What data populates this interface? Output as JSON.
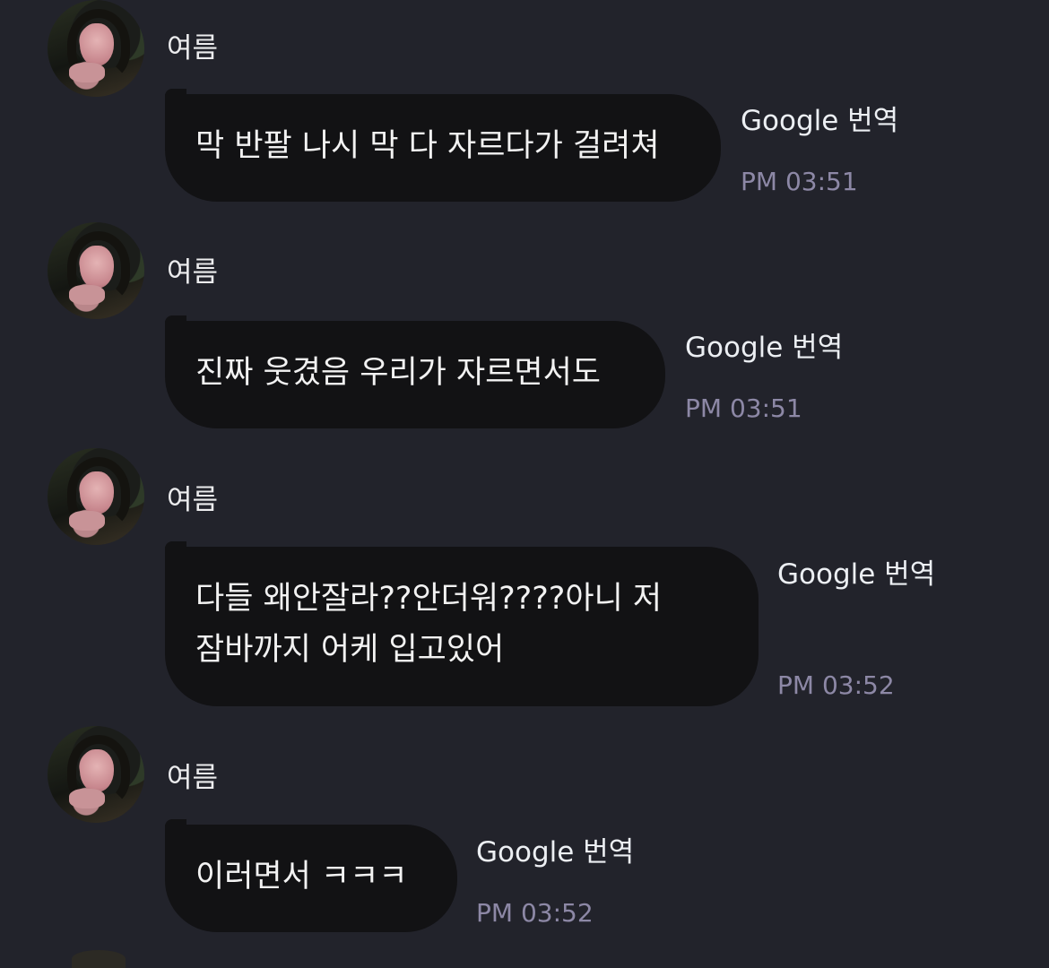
{
  "messages": [
    {
      "sender": "여름",
      "text_lines": [
        "막 반팔 나시 막 다 자르다가 걸려쳐"
      ],
      "translate_label": "Google 번역",
      "time": "PM 03:51"
    },
    {
      "sender": "여름",
      "text_lines": [
        "진짜 웃겼음 우리가 자르면서도"
      ],
      "translate_label": "Google 번역",
      "time": "PM 03:51"
    },
    {
      "sender": "여름",
      "text_lines": [
        "다들 왜안잘라??안더워????아니 저",
        "잠바까지 어케 입고있어"
      ],
      "translate_label": "Google 번역",
      "time": "PM 03:52"
    },
    {
      "sender": "여름",
      "text_lines": [
        "이러면서 ㅋㅋㅋ"
      ],
      "translate_label": "Google 번역",
      "time": "PM 03:52"
    }
  ]
}
